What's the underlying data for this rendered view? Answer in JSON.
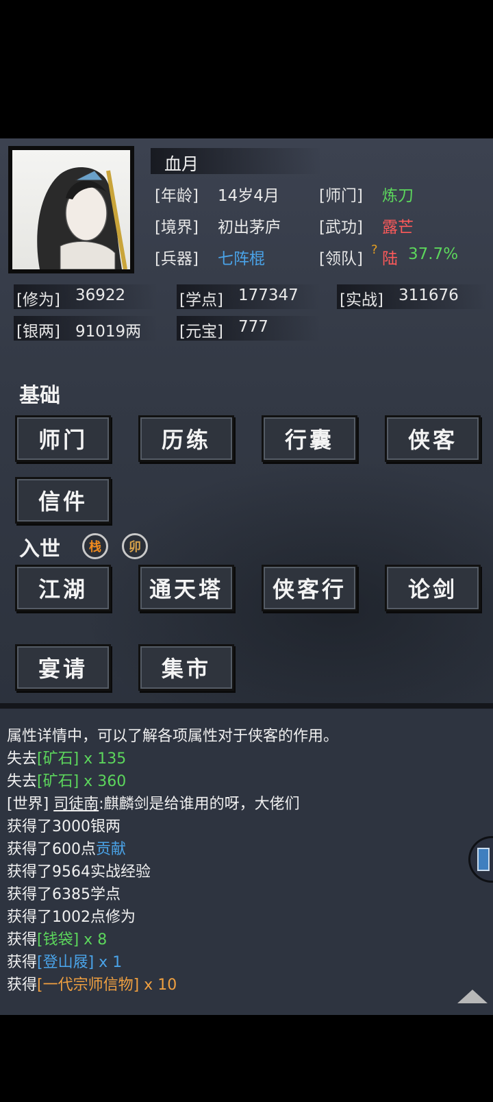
{
  "profile": {
    "name": "血月",
    "age_label": "[年龄]",
    "age": "14岁4月",
    "sect_label": "[师门]",
    "sect": "炼刀",
    "realm_label": "[境界]",
    "realm": "初出茅庐",
    "skill_label": "[武功]",
    "skill": "露芒",
    "weapon_label": "[兵器]",
    "weapon": "七阵棍",
    "team_label": "[领队]",
    "team_q": "?",
    "team": "陆",
    "team_pct": "37.7%"
  },
  "stats": {
    "cultivation_label": "[修为]",
    "cultivation": "36922",
    "study_label": "[学点]",
    "study": "177347",
    "combat_label": "[实战]",
    "combat": "311676",
    "silver_label": "[银两]",
    "silver": "91019两",
    "yuanbao_label": "[元宝]",
    "yuanbao": "777"
  },
  "sections": {
    "basic": {
      "title": "基础",
      "buttons": [
        "师门",
        "历练",
        "行囊",
        "侠客",
        "信件"
      ]
    },
    "world": {
      "title": "入世",
      "seals": [
        "栈",
        "卯"
      ],
      "buttons": [
        "江湖",
        "通天塔",
        "侠客行",
        "论剑",
        "宴请",
        "集市"
      ]
    }
  },
  "log": {
    "line1": "属性详情中，可以了解各项属性对于侠客的作用。",
    "line2_a": "失去",
    "line2_b": "[矿石]",
    "line2_c": " x 135",
    "line3_a": "失去",
    "line3_b": "[矿石]",
    "line3_c": " x 360",
    "line4_a": "[世界] ",
    "line4_b": "司徒南",
    "line4_c": ":麒麟剑是给谁用的呀，大佬们",
    "line5": "获得了3000银两",
    "line6_a": "获得了600点",
    "line6_b": "贡献",
    "line7": "获得了9564实战经验",
    "line8": "获得了6385学点",
    "line9": "获得了1002点修为",
    "line10_a": "获得",
    "line10_b": "[钱袋]",
    "line10_c": " x 8",
    "line11_a": "获得",
    "line11_b": "[登山屐]",
    "line11_c": " x 1",
    "line12_a": "获得",
    "line12_b": "[一代宗师信物]",
    "line12_c": " x 10"
  },
  "colors": {
    "green": "#5cd65c",
    "blue": "#4aa3e8",
    "orange": "#f0a040",
    "red": "#ff5a5a"
  }
}
